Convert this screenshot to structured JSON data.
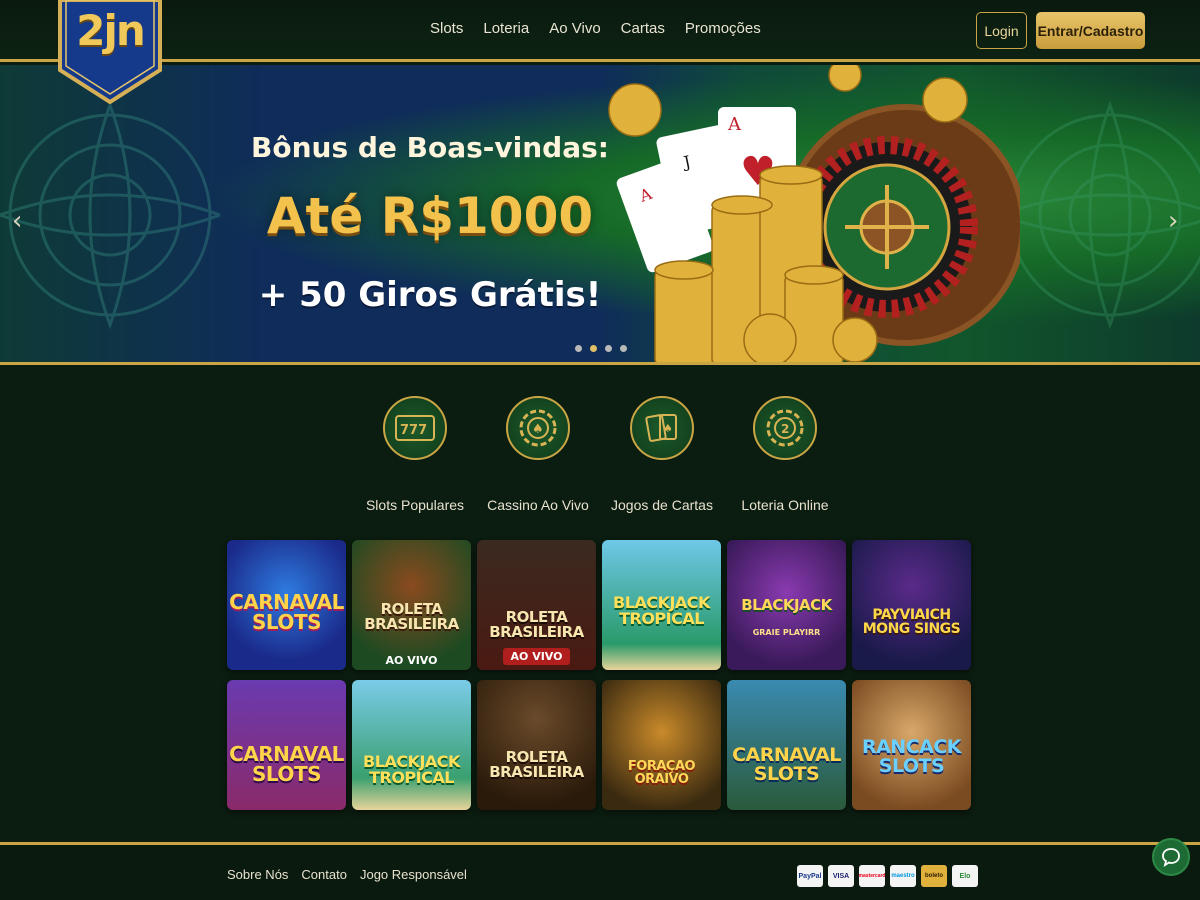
{
  "brand": {
    "logo_text": "2jn"
  },
  "nav": {
    "items": [
      "Slots",
      "Loteria",
      "Ao Vivo",
      "Cartas",
      "Promoções"
    ]
  },
  "auth": {
    "login_label": "Login",
    "signup_label": "Entrar/Cadastro"
  },
  "banner": {
    "line1": "Bônus de Boas-vindas:",
    "line2": "Até R$1000",
    "line3": "+ 50 Giros Grátis!",
    "slide_count": 4,
    "active_slide": 2
  },
  "categories": [
    {
      "label": "Slots Populares",
      "icon": "slot-machine-icon"
    },
    {
      "label": "Cassino Ao Vivo",
      "icon": "poker-chip-icon"
    },
    {
      "label": "Jogos de Cartas",
      "icon": "playing-cards-icon"
    },
    {
      "label": "Loteria Online",
      "icon": "lottery-ball-icon"
    }
  ],
  "games": [
    {
      "title": "CARNAVAL SLOTS",
      "sub": ""
    },
    {
      "title": "ROLETA BRASILEIRA",
      "sub": "AO VIVO"
    },
    {
      "title": "ROLETA BRASILEIRA",
      "sub": "AO VIVO"
    },
    {
      "title": "BLACKJACK TROPICAL",
      "sub": ""
    },
    {
      "title": "BLACKJACK",
      "sub": "GRAIE PLAYIRR"
    },
    {
      "title": "PAYVIAICH MONG SINGS",
      "sub": ""
    },
    {
      "title": "CARNAVAL SLOTS",
      "sub": ""
    },
    {
      "title": "BLACKJACK TROPICAL",
      "sub": ""
    },
    {
      "title": "ROLETA BRASILEIRA",
      "sub": ""
    },
    {
      "title": "FORAÇAO ORAIVO",
      "sub": ""
    },
    {
      "title": "CARNAVAL SLOTS",
      "sub": ""
    },
    {
      "title": "RANCACK SLOTS",
      "sub": ""
    }
  ],
  "footer": {
    "links": [
      "Sobre Nós",
      "Contato",
      "Jogo Responsável"
    ],
    "payments": [
      "PayPal",
      "VISA",
      "mastercard",
      "maestro",
      "boleto",
      "Elo"
    ]
  },
  "colors": {
    "accent_gold": "#c9a545",
    "background": "#0b1c10",
    "banner_blue": "#0f2c5a",
    "banner_green": "#166a28"
  }
}
